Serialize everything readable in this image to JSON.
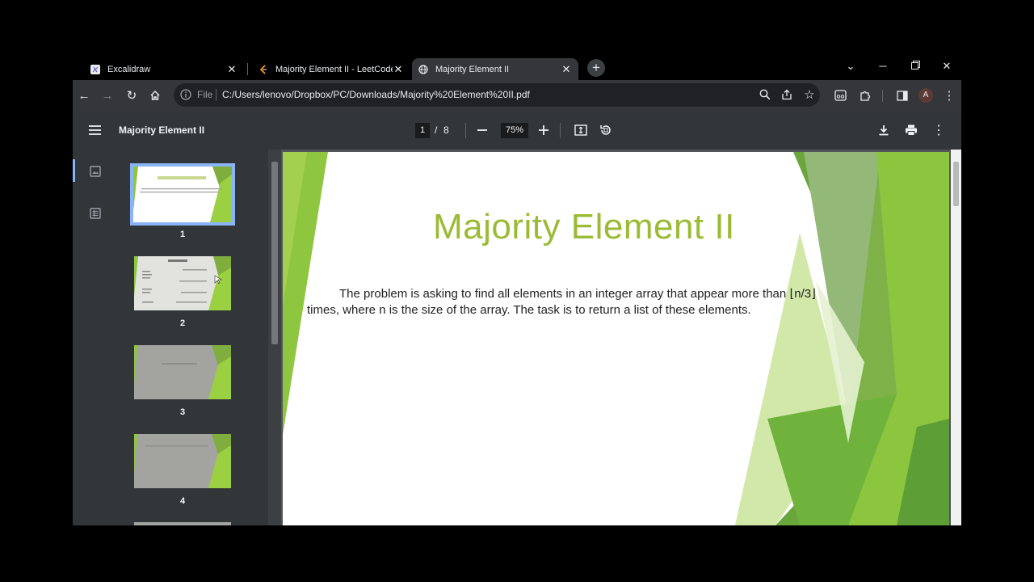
{
  "tabs": [
    {
      "title": "Excalidraw",
      "icon": "excalidraw-icon",
      "active": false
    },
    {
      "title": "Majority Element II - LeetCode",
      "icon": "leetcode-icon",
      "active": false
    },
    {
      "title": "Majority Element II",
      "icon": "globe-icon",
      "active": true
    }
  ],
  "omnibox": {
    "scheme_label": "File",
    "url": "C:/Users/lenovo/Dropbox/PC/Downloads/Majority%20Element%20II.pdf"
  },
  "profile": {
    "initial": "A"
  },
  "pdf": {
    "title": "Majority Element II",
    "current_page": "1",
    "page_separator": "/",
    "total_pages": "8",
    "zoom": "75%"
  },
  "thumbnails": [
    {
      "number": "1",
      "selected": true
    },
    {
      "number": "2",
      "selected": false
    },
    {
      "number": "3",
      "selected": false
    },
    {
      "number": "4",
      "selected": false
    }
  ],
  "slide": {
    "title": "Majority Element II",
    "body": "The problem is asking to find all elements in an integer array that appear more than ⌊n/3⌋ times, where n is the size of the array. The task is to return a list of these elements."
  },
  "colors": {
    "slide_title": "#9bbb35",
    "accent_green": "#8fc640",
    "dark_green": "#62a83a",
    "selection": "#8ab4f8"
  }
}
